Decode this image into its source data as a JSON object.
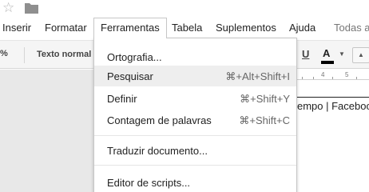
{
  "title_bar": {
    "star_icon": "star-icon",
    "folder_icon": "folder-icon"
  },
  "menubar": {
    "items": [
      "Inserir",
      "Formatar",
      "Ferramentas",
      "Tabela",
      "Suplementos",
      "Ajuda",
      "Todas a"
    ]
  },
  "toolbar": {
    "zoom_fragment": "%",
    "style": "Texto normal",
    "underline": "U",
    "text_color": "A"
  },
  "ruler": {
    "marks": [
      "4",
      "5"
    ]
  },
  "document": {
    "visible_text": "empo | Faceboo"
  },
  "tools_menu": {
    "items": [
      {
        "label": "Ortografia...",
        "shortcut": ""
      },
      {
        "label": "Pesquisar",
        "shortcut": "⌘+Alt+Shift+I"
      },
      {
        "label": "Definir",
        "shortcut": "⌘+Shift+Y"
      },
      {
        "label": "Contagem de palavras",
        "shortcut": "⌘+Shift+C"
      },
      {
        "label": "Traduzir documento...",
        "shortcut": ""
      },
      {
        "label": "Editor de scripts...",
        "shortcut": ""
      }
    ]
  }
}
